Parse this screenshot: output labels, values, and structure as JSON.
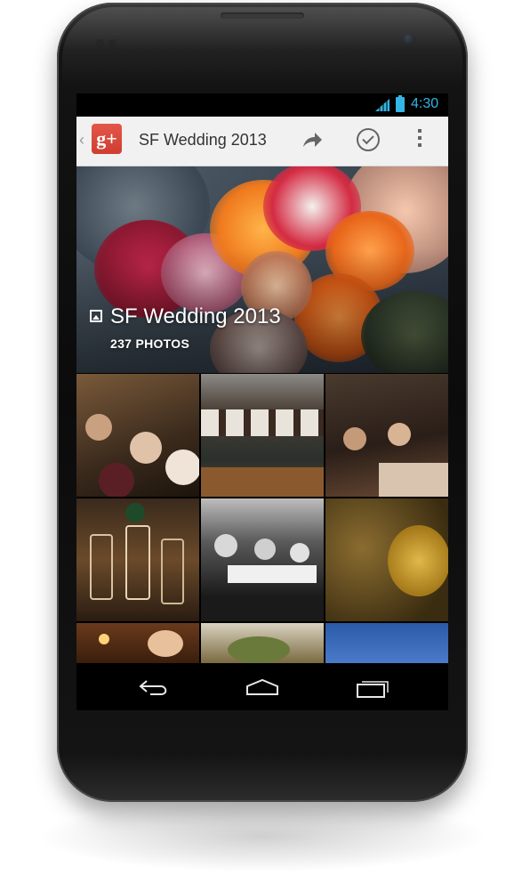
{
  "statusbar": {
    "time": "4:30",
    "icons": [
      "signal-icon",
      "battery-icon"
    ],
    "accent_color": "#33b5e5"
  },
  "actionbar": {
    "app_icon": "google-plus-icon",
    "app_logo_text": "g+",
    "title": "SF Wedding 2013",
    "actions": [
      "share-icon",
      "select-check-icon",
      "overflow-menu-icon"
    ]
  },
  "album": {
    "title": "SF Wedding 2013",
    "photo_count": "237 PHOTOS",
    "icon": "album-icon"
  },
  "grid": {
    "tiles": [
      "reception-dinner-photo",
      "banquet-hall-photo",
      "dinner-table-photo",
      "glassware-photo",
      "black-and-white-guests-photo",
      "golden-flowers-photo",
      "candles-photo",
      "food-plate-photo",
      "sky-photo"
    ]
  },
  "navbar": {
    "buttons": [
      "back-icon",
      "home-icon",
      "recent-apps-icon"
    ]
  }
}
